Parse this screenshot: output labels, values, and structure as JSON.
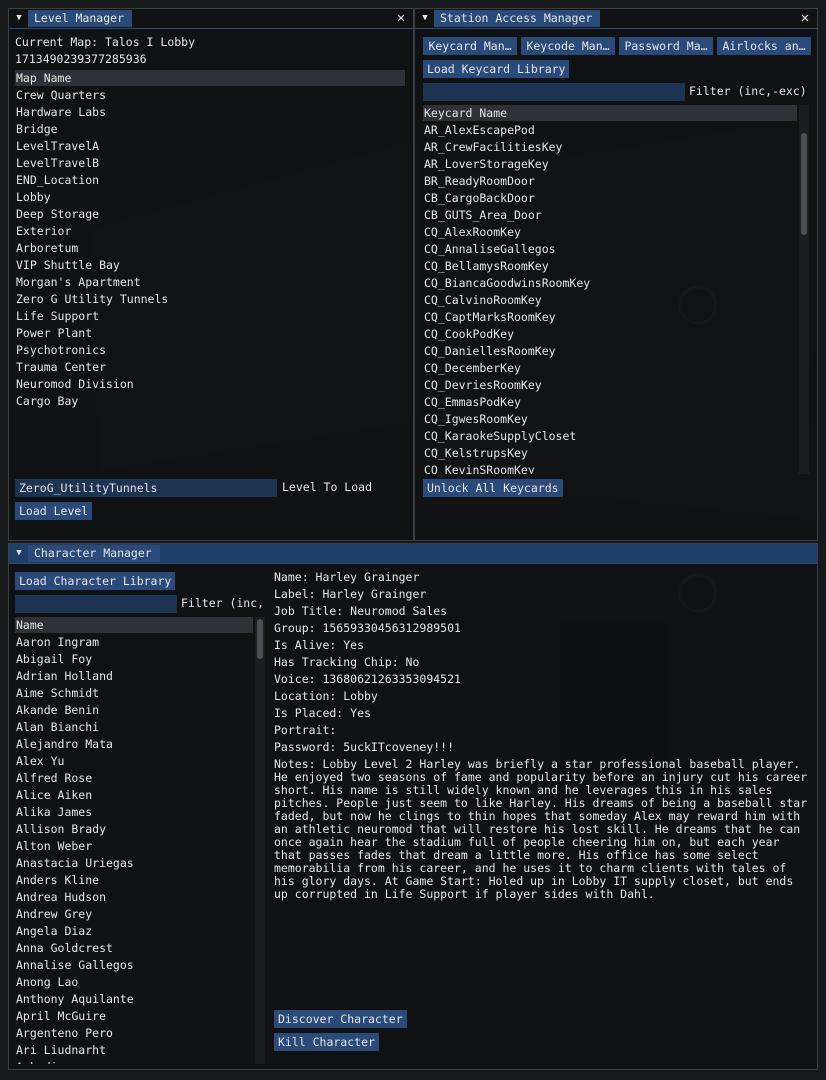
{
  "level_manager": {
    "title": "Level Manager",
    "current_map_label": "Current Map: Talos I Lobby",
    "map_id": "1713490239377285936",
    "column_header": "Map Name",
    "maps": [
      "Crew Quarters",
      "Hardware Labs",
      "Bridge",
      "LevelTravelA",
      "LevelTravelB",
      "END_Location",
      "Lobby",
      "Deep Storage",
      "Exterior",
      "Arboretum",
      "VIP Shuttle Bay",
      "Morgan's Apartment",
      "Zero G Utility Tunnels",
      "Life Support",
      "Power Plant",
      "Psychotronics",
      "Trauma Center",
      "Neuromod Division",
      "Cargo Bay"
    ],
    "level_input_value": "ZeroG_UtilityTunnels",
    "level_input_label": "Level To Load",
    "load_button": "Load Level"
  },
  "station_access": {
    "title": "Station Access Manager",
    "tabs": [
      "Keycard Man…",
      "Keycode Man…",
      "Password Ma…",
      "Airlocks an…"
    ],
    "load_library_button": "Load Keycard Library",
    "filter_value": "",
    "filter_label": "Filter (inc,-exc)",
    "column_header": "Keycard Name",
    "keycards": [
      "AR_AlexEscapePod",
      "AR_CrewFacilitiesKey",
      "AR_LoverStorageKey",
      "BR_ReadyRoomDoor",
      "CB_CargoBackDoor",
      "CB_GUTS_Area_Door",
      "CQ_AlexRoomKey",
      "CQ_AnnaliseGallegos",
      "CQ_BellamysRoomKey",
      "CQ_BiancaGoodwinsRoomKey",
      "CQ_CalvinoRoomKey",
      "CQ_CaptMarksRoomKey",
      "CQ_CookPodKey",
      "CQ_DaniellesRoomKey",
      "CQ_DecemberKey",
      "CQ_DevriesRoomKey",
      "CQ_EmmasPodKey",
      "CQ_IgwesRoomKey",
      "CQ_KaraokeSupplyCloset",
      "CQ_KelstrupsKey",
      "CQ_KevinSRoomKey"
    ],
    "unlock_button": "Unlock All Keycards"
  },
  "character_manager": {
    "title": "Character Manager",
    "load_library_button": "Load Character Library",
    "filter_value": "",
    "filter_label": "Filter (inc,",
    "column_header": "Name",
    "characters": [
      "Aaron Ingram",
      "Abigail Foy",
      "Adrian Holland",
      "Aime Schmidt",
      "Akande Benin",
      "Alan Bianchi",
      "Alejandro Mata",
      "Alex Yu",
      "Alfred Rose",
      "Alice Aiken",
      "Alika James",
      "Allison Brady",
      "Alton Weber",
      "Anastacia Uriegas",
      "Anders Kline",
      "Andrea Hudson",
      "Andrew Grey",
      "Angela Diaz",
      "Anna Goldcrest",
      "Annalise Gallegos",
      "Anong Lao",
      "Anthony Aquilante",
      "April McGuire",
      "Argenteno Pero",
      "Ari Liudnarht",
      "Arkadi..."
    ],
    "details": {
      "name": "Name: Harley Grainger",
      "label": "Label: Harley Grainger",
      "job_title": "Job Title: Neuromod Sales",
      "group": "Group: 15659330456312989501",
      "is_alive": "Is Alive: Yes",
      "tracking_chip": "Has Tracking Chip: No",
      "voice": "Voice: 13680621263353094521",
      "location": "Location: Lobby",
      "is_placed": "Is Placed: Yes",
      "portrait": "Portrait:",
      "password": "Password: 5uckITcoveney!!!",
      "notes": "Notes: Lobby Level 2  Harley was briefly a star professional baseball player. He enjoyed two seasons of fame and popularity before an injury cut his career short. His name is still widely known and he leverages this in his sales pitches. People just seem to like Harley. His dreams of being a baseball star faded, but now he clings to thin hopes that someday Alex may reward him with an athletic neuromod that will restore his lost skill. He dreams that he can once again hear the stadium full of people cheering him on, but each year that passes fades that dream a little more.    His office has some select memorabilia from his career, and he uses it to charm clients with tales of his glory days.    At Game Start: Holed up in Lobby IT supply closet, but ends up corrupted in Life Support if player sides with Dahl."
    },
    "discover_button": "Discover Character",
    "kill_button": "Kill Character"
  },
  "colors": {
    "title_active": "#1f3f6b",
    "button": "#2a4a7a",
    "input": "#1d3352",
    "header_row": "#2e3138",
    "text": "#e6e6e6"
  }
}
